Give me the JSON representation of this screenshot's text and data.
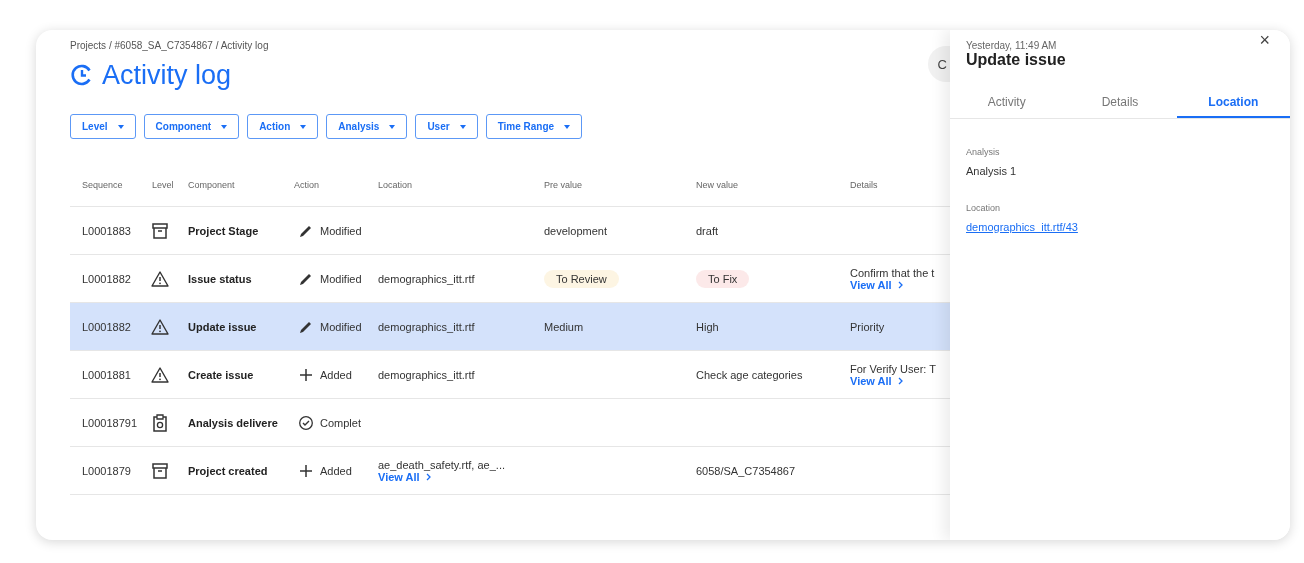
{
  "breadcrumb": "Projects / #6058_SA_C7354867 / Activity log",
  "title": "Activity log",
  "header_button": "C",
  "filters": [
    {
      "label": "Level"
    },
    {
      "label": "Component"
    },
    {
      "label": "Action"
    },
    {
      "label": "Analysis"
    },
    {
      "label": "User"
    },
    {
      "label": "Time Range"
    }
  ],
  "table": {
    "columns": [
      "Sequence",
      "Level",
      "Component",
      "Action",
      "Location",
      "Pre value",
      "New value",
      "Details"
    ],
    "rows": [
      {
        "selected": false,
        "sequence": "L0001883",
        "level": {
          "kind": "archive"
        },
        "component": "Project Stage",
        "action": {
          "kind": "edit",
          "text": "Modified"
        },
        "location": {},
        "pre_value": {
          "text": "development"
        },
        "new_value": {
          "text": "draft"
        },
        "details": {}
      },
      {
        "selected": false,
        "sequence": "L0001882",
        "level": {
          "kind": "warning"
        },
        "component": "Issue status",
        "action": {
          "kind": "edit",
          "text": "Modified"
        },
        "location": {
          "text": "demographics_itt.rtf"
        },
        "pre_value": {
          "text": "To Review",
          "color": "#fdf5e3"
        },
        "new_value": {
          "text": "To Fix",
          "color": "#fce9e9"
        },
        "details": {
          "text": "Confirm that the t",
          "link": "View All"
        }
      },
      {
        "selected": true,
        "sequence": "L0001882",
        "level": {
          "kind": "warning"
        },
        "component": "Update issue",
        "action": {
          "kind": "edit",
          "text": "Modified"
        },
        "location": {
          "text": "demographics_itt.rtf"
        },
        "pre_value": {
          "text": "Medium"
        },
        "new_value": {
          "text": "High"
        },
        "details": {
          "text": "Priority"
        }
      },
      {
        "selected": false,
        "sequence": "L0001881",
        "level": {
          "kind": "warning"
        },
        "component": "Create issue",
        "action": {
          "kind": "add",
          "text": "Added"
        },
        "location": {
          "text": "demographics_itt.rtf"
        },
        "pre_value": {},
        "new_value": {
          "text": "Check age categories"
        },
        "details": {
          "text": "For Verify User: T",
          "link": "View All"
        }
      },
      {
        "selected": false,
        "sequence": "L00018791",
        "level": {
          "kind": "clipboard"
        },
        "component": "Analysis delivere",
        "action": {
          "kind": "complete",
          "text": "Complet"
        },
        "location": {},
        "pre_value": {},
        "new_value": {},
        "details": {}
      },
      {
        "selected": false,
        "sequence": "L0001879",
        "level": {
          "kind": "archive"
        },
        "component": "Project created",
        "action": {
          "kind": "add",
          "text": "Added"
        },
        "location": {
          "text": "ae_death_safety.rtf, ae_...",
          "link": "View All"
        },
        "pre_value": {},
        "new_value": {
          "text": "6058/SA_C7354867"
        },
        "details": {}
      }
    ]
  },
  "drawer": {
    "timestamp": "Yesterday, 11:49 AM",
    "title": "Update issue",
    "close": "×",
    "tabs": [
      {
        "label": "Activity",
        "selected": false
      },
      {
        "label": "Details",
        "selected": false
      },
      {
        "label": "Location",
        "selected": true
      }
    ],
    "fields": [
      {
        "label": "Analysis",
        "kind": "text",
        "value": "Analysis 1"
      },
      {
        "label": "Location",
        "kind": "link",
        "value": "demographics_itt.rtf/43"
      }
    ]
  }
}
